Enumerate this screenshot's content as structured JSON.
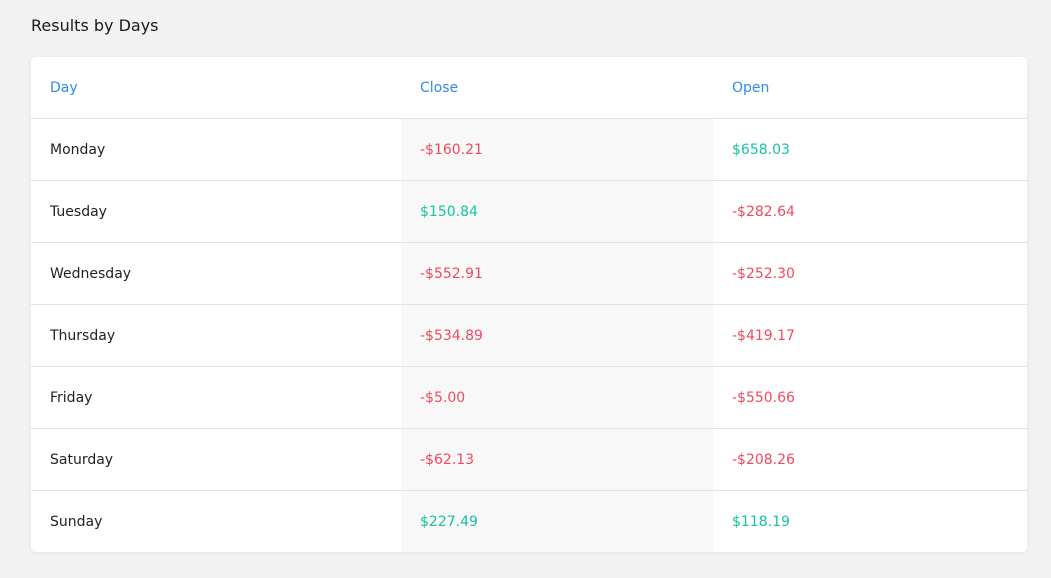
{
  "section_title": "Results by Days",
  "colors": {
    "header": "#2f8ce8",
    "negative": "#f2495c",
    "positive": "#15c3a5"
  },
  "table": {
    "headers": [
      "Day",
      "Close",
      "Open"
    ],
    "rows": [
      {
        "day": "Monday",
        "close": "-$160.21",
        "open": "$658.03"
      },
      {
        "day": "Tuesday",
        "close": "$150.84",
        "open": "-$282.64"
      },
      {
        "day": "Wednesday",
        "close": "-$552.91",
        "open": "-$252.30"
      },
      {
        "day": "Thursday",
        "close": "-$534.89",
        "open": "-$419.17"
      },
      {
        "day": "Friday",
        "close": "-$5.00",
        "open": "-$550.66"
      },
      {
        "day": "Saturday",
        "close": "-$62.13",
        "open": "-$208.26"
      },
      {
        "day": "Sunday",
        "close": "$227.49",
        "open": "$118.19"
      }
    ]
  }
}
